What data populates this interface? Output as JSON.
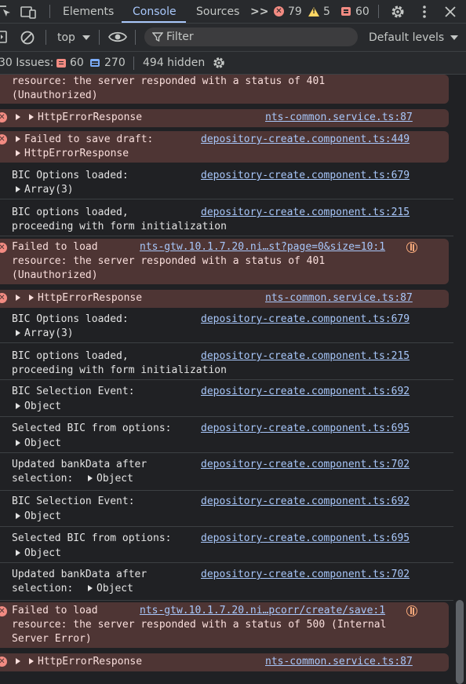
{
  "tabs": {
    "elements": "Elements",
    "console": "Console",
    "sources": "Sources",
    "more": ">>",
    "error_count": "79",
    "warning_count": "5",
    "issue_count": "60"
  },
  "toolbar": {
    "context": "top",
    "filter_placeholder": "Filter",
    "levels": "Default levels"
  },
  "issues_bar": {
    "issues_label": "30 Issues:",
    "error_issues": "60",
    "info_issues": "270",
    "hidden": "494 hidden"
  },
  "console": {
    "m0_l1": "resource: the server responded with a status of 401",
    "m0_l2": "(Unauthorized)",
    "m1_text": "HttpErrorResponse",
    "m1_src": "nts-common.service.ts:87",
    "m2_l1": "Failed to save draft:",
    "m2_l2": "HttpErrorResponse",
    "m2_src": "depository-create.component.ts:449",
    "m3_l1": "BIC Options loaded:",
    "m3_l2": "Array(3)",
    "m3_src": "depository-create.component.ts:679",
    "m4_l1": "BIC options loaded,",
    "m4_l2": "proceeding with form initialization",
    "m4_src": "depository-create.component.ts:215",
    "m5_l1": "Failed to load",
    "m5_l2": "resource: the server responded with a status of 401",
    "m5_l3": "(Unauthorized)",
    "m5_src": "nts-gtw.10.1.7.20.ni…st?page=0&size=10:1",
    "m6_text": "HttpErrorResponse",
    "m6_src": "nts-common.service.ts:87",
    "m7_l1": "BIC Options loaded:",
    "m7_l2": "Array(3)",
    "m7_src": "depository-create.component.ts:679",
    "m8_l1": "BIC options loaded,",
    "m8_l2": "proceeding with form initialization",
    "m8_src": "depository-create.component.ts:215",
    "m9_l1": "BIC Selection Event:",
    "m9_l2": "Object",
    "m9_src": "depository-create.component.ts:692",
    "m10_l1": "Selected BIC from options:",
    "m10_l2": "Object",
    "m10_src": "depository-create.component.ts:695",
    "m11_l1": "Updated bankData after",
    "m11_l2a": "selection:",
    "m11_l2b": "Object",
    "m11_src": "depository-create.component.ts:702",
    "m12_l1": "BIC Selection Event:",
    "m12_l2": "Object",
    "m12_src": "depository-create.component.ts:692",
    "m13_l1": "Selected BIC from options:",
    "m13_l2": "Object",
    "m13_src": "depository-create.component.ts:695",
    "m14_l1": "Updated bankData after",
    "m14_l2a": "selection:",
    "m14_l2b": "Object",
    "m14_src": "depository-create.component.ts:702",
    "m15_l1": "Failed to load",
    "m15_l2": "resource: the server responded with a status of 500 (Internal",
    "m15_l3": "Server Error)",
    "m15_src": "nts-gtw.10.1.7.20.ni…pcorr/create/save:1",
    "m16_text": "HttpErrorResponse",
    "m16_src": "nts-common.service.ts:87"
  },
  "colors": {
    "error_bg": "#4e3534",
    "error_red": "#f28b82",
    "link_blue": "#a8c7fa",
    "warning_yellow": "#fdd663"
  }
}
